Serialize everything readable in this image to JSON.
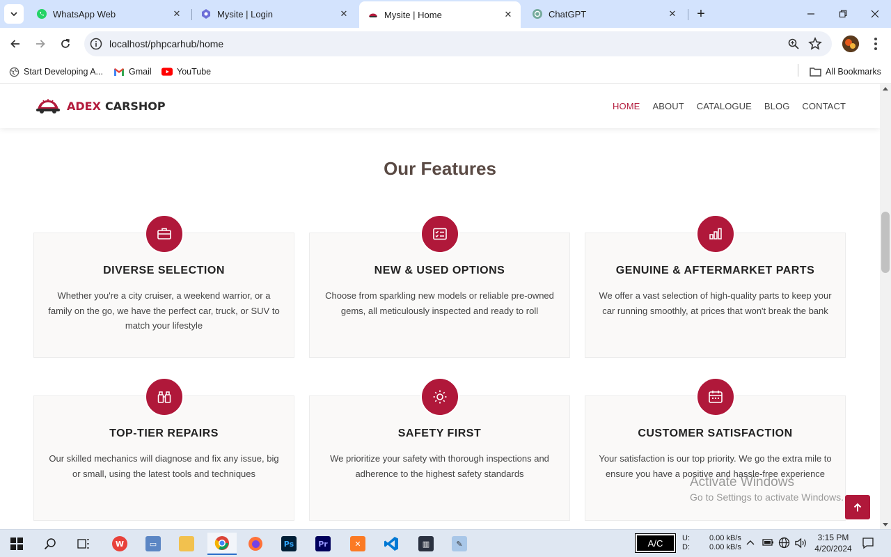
{
  "browser": {
    "tabs": [
      {
        "title": "WhatsApp Web"
      },
      {
        "title": "Mysite | Login"
      },
      {
        "title": "Mysite | Home",
        "active": true
      },
      {
        "title": "ChatGPT"
      }
    ],
    "url": "localhost/phpcarhub/home",
    "bookmarks": [
      {
        "label": "Start Developing A..."
      },
      {
        "label": "Gmail"
      },
      {
        "label": "YouTube"
      }
    ],
    "all_bookmarks": "All Bookmarks"
  },
  "site": {
    "brand_primary": "ADEX",
    "brand_secondary": "CARSHOP",
    "accent_color": "#b0183a",
    "nav": [
      {
        "label": "HOME",
        "active": true
      },
      {
        "label": "ABOUT"
      },
      {
        "label": "CATALOGUE"
      },
      {
        "label": "BLOG"
      },
      {
        "label": "CONTACT"
      }
    ],
    "section_title_light": "Our",
    "section_title_bold": "Features",
    "features": [
      {
        "icon": "briefcase-icon",
        "title": "DIVERSE SELECTION",
        "text": "Whether you're a city cruiser, a weekend warrior, or a family on the go, we have the perfect car, truck, or SUV to match your lifestyle"
      },
      {
        "icon": "checklist-icon",
        "title": "NEW & USED OPTIONS",
        "text": "Choose from sparkling new models or reliable pre-owned gems, all meticulously inspected and ready to roll"
      },
      {
        "icon": "bar-chart-icon",
        "title": "GENUINE & AFTERMARKET PARTS",
        "text": "We offer a vast selection of high-quality parts to keep your car running smoothly, at prices that won't break the bank"
      },
      {
        "icon": "binoculars-icon",
        "title": "TOP-TIER REPAIRS",
        "text": "Our skilled mechanics will diagnose and fix any issue, big or small, using the latest tools and techniques"
      },
      {
        "icon": "sun-icon",
        "title": "SAFETY FIRST",
        "text": "We prioritize your safety with thorough inspections and adherence to the highest safety standards"
      },
      {
        "icon": "calendar-icon",
        "title": "CUSTOMER SATISFACTION",
        "text": "Your satisfaction is our top priority. We go the extra mile to ensure you have a positive and hassle-free experience"
      }
    ]
  },
  "overlay": {
    "watermark_title": "Activate Windows",
    "watermark_sub": "Go to Settings to activate Windows."
  },
  "taskbar": {
    "ac_label": "A/C",
    "net_up_label": "U:",
    "net_down_label": "D:",
    "net_up": "0.00 kB/s",
    "net_down": "0.00 kB/s",
    "time": "3:15 PM",
    "date": "4/20/2024"
  }
}
